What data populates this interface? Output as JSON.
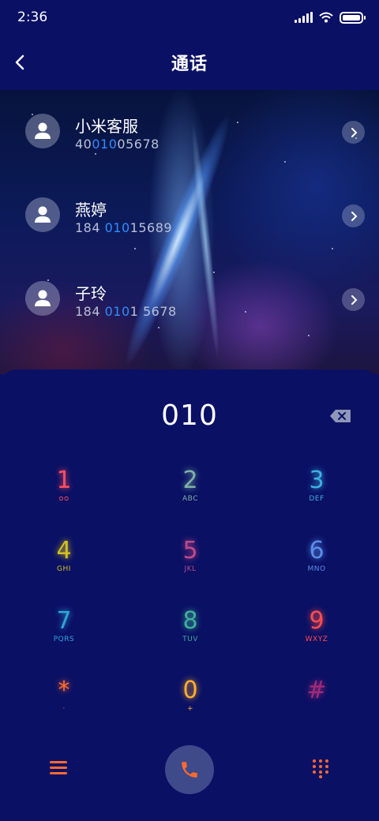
{
  "status_bar": {
    "time": "2:36"
  },
  "header": {
    "title": "通话"
  },
  "contacts": [
    {
      "name": "小米客服",
      "num_pre": "40",
      "num_hl": "010",
      "num_post": "05678"
    },
    {
      "name": "燕婷",
      "num_pre": "184 ",
      "num_hl": "010",
      "num_post": "15689"
    },
    {
      "name": "子玲",
      "num_pre": "184 ",
      "num_hl": "010",
      "num_post": "1 5678"
    }
  ],
  "dialer": {
    "typed_number": "010",
    "keys": [
      {
        "digit": "1",
        "letters": "ᴑᴑ",
        "color": "#ff4d5f"
      },
      {
        "digit": "2",
        "letters": "ABC",
        "color": "#7fb3a4"
      },
      {
        "digit": "3",
        "letters": "DEF",
        "color": "#3fb0e0"
      },
      {
        "digit": "4",
        "letters": "GHI",
        "color": "#d4c020"
      },
      {
        "digit": "5",
        "letters": "JKL",
        "color": "#c04a8a"
      },
      {
        "digit": "6",
        "letters": "MNO",
        "color": "#5a8ee8"
      },
      {
        "digit": "7",
        "letters": "PQRS",
        "color": "#2fa6d8"
      },
      {
        "digit": "8",
        "letters": "TUV",
        "color": "#3fb09a"
      },
      {
        "digit": "9",
        "letters": "WXYZ",
        "color": "#ff4d4d"
      },
      {
        "digit": "*",
        "letters": "·",
        "color": "#ff6a2e"
      },
      {
        "digit": "0",
        "letters": "+",
        "color": "#ffae2e"
      },
      {
        "digit": "#",
        "letters": "",
        "color": "#a02a7a"
      }
    ]
  },
  "bottom_bar": {
    "accent": "#ff6a2e",
    "icons": [
      "menu-icon",
      "phone-icon",
      "keypad-icon"
    ]
  }
}
